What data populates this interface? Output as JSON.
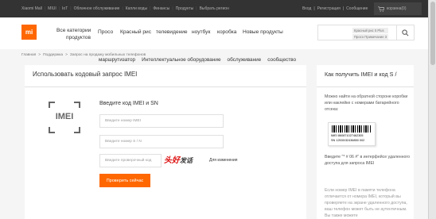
{
  "topbar": {
    "left_links": [
      "Xiaomi Mall",
      "MIUI",
      "IoT",
      "Облачное обслуживание",
      "Капли воды",
      "Финансы",
      "Продукты",
      "Выбрать регион"
    ],
    "right_links": [
      "Вход",
      "Регистрация",
      "Сообщение"
    ],
    "cart_label": "корзина(0)",
    "cart_icon": "cart-icon"
  },
  "header": {
    "logo_text": "mi",
    "brand_color": "#ff6700",
    "all_categories_line1": "Все категории",
    "all_categories_line2": "продуктов",
    "nav": [
      "Просо",
      "Красный рис",
      "телевидение",
      "ноутбук",
      "коробка",
      "Новые продукты"
    ],
    "search_hints": [
      "Красный рис 5 Plus",
      "Просо Примечание 3"
    ],
    "search_icon": "search-icon"
  },
  "breadcrumb": [
    "Главная",
    ">",
    "Поддержка",
    ">",
    "Запрос на продажу мобильных телефонов"
  ],
  "subnav": [
    "маршрутизатор",
    "Интеллектуальное оборудование",
    "обслуживание",
    "сообщество"
  ],
  "main": {
    "title": "Использовать кодовый запрос IMEI",
    "logo_text": "IMEI",
    "form_label": "Введите код IMEI и SN",
    "imei_placeholder": "Введите номер IMEI",
    "sn_placeholder": "Введите номер S / N",
    "captcha_placeholder": "Введите проверочный код",
    "captcha_text_1": "头好",
    "captcha_text_2": "发话",
    "refresh_label": "Для изменения",
    "submit_label": "Проверить сейчас"
  },
  "side": {
    "title": "Как получить IMEI и код S /",
    "para1": "Можно найти на обратной стороне коробки или наклейке с номерами батарейного отсека:",
    "barcode_line1": "IMEI 860871027462305",
    "barcode_line2": "SN 12530/32436850      002",
    "para2": "Введите \"* # 06 #\" в интерфейсе удаленного доступа для запроса IMEI",
    "para3": "Если номер IMEI в памяти телефона отличается от номера IMEI, который вы проверяете на экране удаленного доступа, ваш телефон может быть не аутентичным. Вы также можете"
  }
}
